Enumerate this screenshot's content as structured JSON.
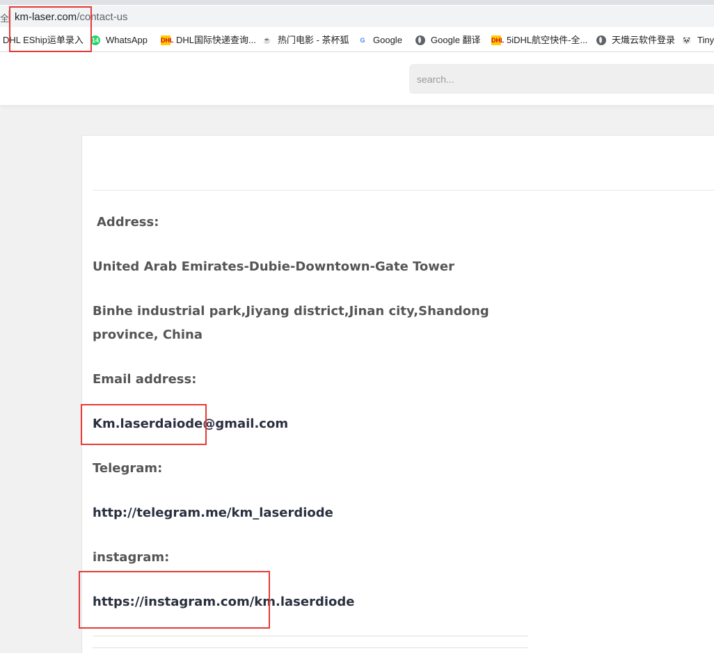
{
  "browser": {
    "url_host": "km-laser.com",
    "url_path": "/contact-us",
    "lock_glyph": "全",
    "bookmarks": [
      {
        "label": "DHL EShip运单录入",
        "icon": "none"
      },
      {
        "label": "WhatsApp",
        "icon": "whatsapp-icon",
        "badge": "14"
      },
      {
        "label": "DHL国际快递查询...",
        "icon": "dhl-icon"
      },
      {
        "label": "热门电影 - 茶杯狐",
        "icon": "teacup-fox-icon"
      },
      {
        "label": "Google",
        "icon": "google-icon"
      },
      {
        "label": "Google 翻译",
        "icon": "globe-icon"
      },
      {
        "label": "5iDHL航空快件-全...",
        "icon": "dhl-icon"
      },
      {
        "label": "天熾云软件登录",
        "icon": "globe-icon"
      },
      {
        "label": "Tiny",
        "icon": "panda-icon"
      }
    ]
  },
  "header": {
    "search_placeholder": "search..."
  },
  "contact": {
    "address_label": "Address:",
    "address_line_1": "United Arab Emirates-Dubie-Downtown-Gate Tower",
    "address_line_2": "Binhe industrial park,Jiyang district,Jinan city,Shandong province, China",
    "email_label": "Email address:",
    "email_value": "Km.laserdaiode@gmail.com",
    "telegram_label": "Telegram:",
    "telegram_value": "http://telegram.me/km_laserdiode",
    "instagram_label": "instagram:",
    "instagram_value": "https://instagram.com/km.laserdiode"
  },
  "colors": {
    "annotation": "#e53935",
    "text_label": "#555555",
    "text_link": "#2a2f3f"
  }
}
